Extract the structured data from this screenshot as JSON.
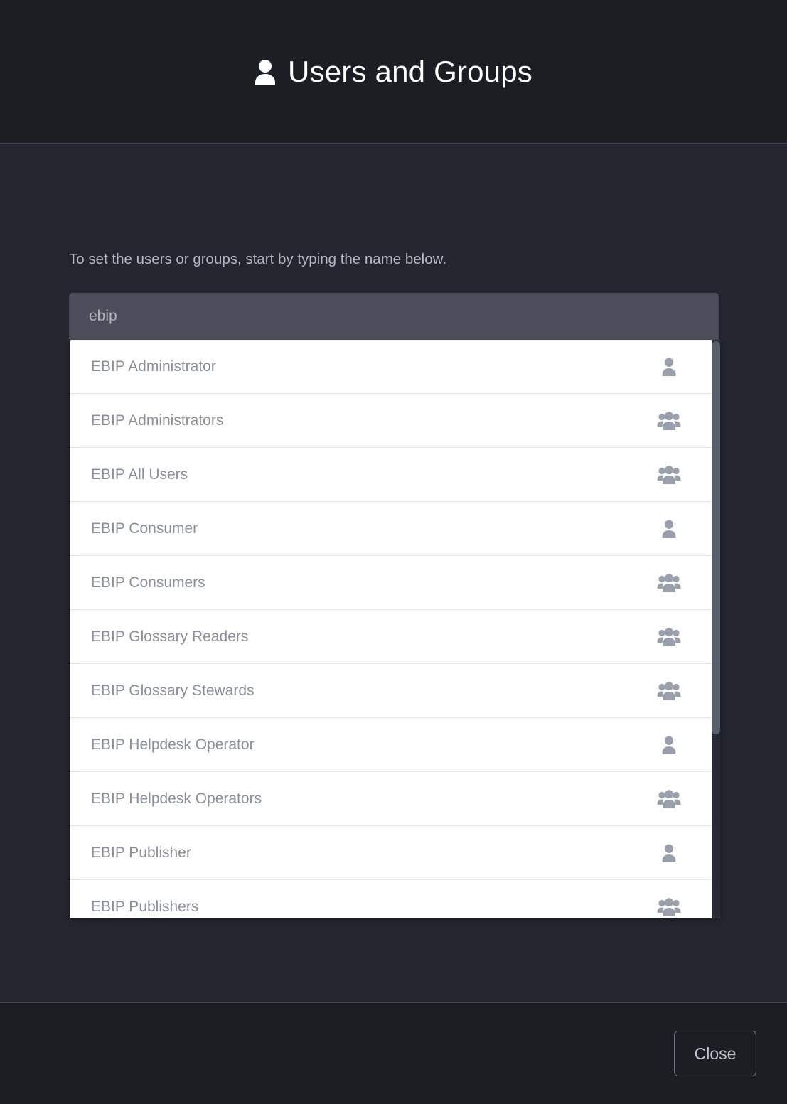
{
  "header": {
    "title": "Users and Groups",
    "icon": "person-icon"
  },
  "body": {
    "instruction": "To set the users or groups, start by typing the name below.",
    "search": {
      "value": "ebip",
      "placeholder": "ebip"
    },
    "dropdown": {
      "items": [
        {
          "label": "EBIP Administrator",
          "icon": "user-icon"
        },
        {
          "label": "EBIP Administrators",
          "icon": "group-icon"
        },
        {
          "label": "EBIP All Users",
          "icon": "group-icon"
        },
        {
          "label": "EBIP Consumer",
          "icon": "user-icon"
        },
        {
          "label": "EBIP Consumers",
          "icon": "group-icon"
        },
        {
          "label": "EBIP Glossary Readers",
          "icon": "group-icon"
        },
        {
          "label": "EBIP Glossary Stewards",
          "icon": "group-icon"
        },
        {
          "label": "EBIP Helpdesk Operator",
          "icon": "user-icon"
        },
        {
          "label": "EBIP Helpdesk Operators",
          "icon": "group-icon"
        },
        {
          "label": "EBIP Publisher",
          "icon": "user-icon"
        },
        {
          "label": "EBIP Publishers",
          "icon": "group-icon"
        }
      ]
    }
  },
  "footer": {
    "close_label": "Close"
  },
  "colors": {
    "header_bg": "#1c1e24",
    "body_bg": "#24262f",
    "input_bg": "#4b4e5a",
    "dropdown_bg": "#ffffff",
    "item_text": "#8a8f99",
    "icon_gray": "#9aa0ab",
    "border": "#464a57"
  }
}
